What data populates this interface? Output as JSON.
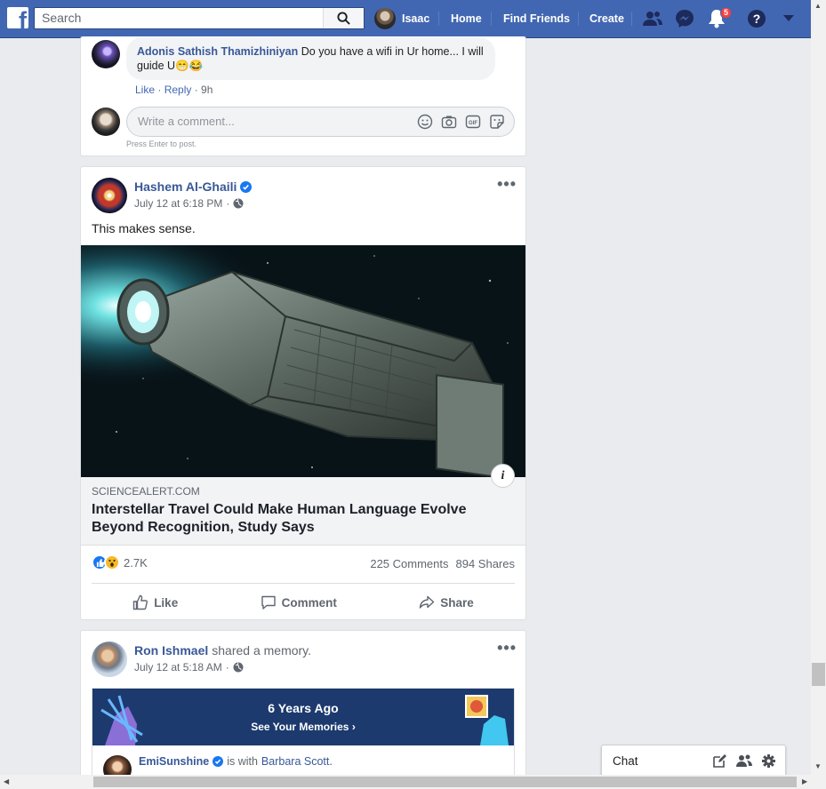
{
  "topbar": {
    "search_placeholder": "Search",
    "user_name": "Isaac",
    "nav": [
      "Home",
      "Find Friends",
      "Create"
    ],
    "notification_count": "5",
    "brand_color": "#4267b2"
  },
  "comment": {
    "author": "Adonis Sathish Thamizhiniyan",
    "text": "Do you have a wifi in Ur home... I will guide U😁😂",
    "like": "Like",
    "reply": "Reply",
    "time": "9h",
    "write_placeholder": "Write a comment...",
    "hint": "Press Enter to post."
  },
  "post1": {
    "author": "Hashem Al-Ghaili",
    "time": "July 12 at 6:18 PM",
    "text": "This makes sense.",
    "link_domain": "SCIENCEALERT.COM",
    "link_title": "Interstellar Travel Could Make Human Language Evolve Beyond Recognition, Study Says",
    "reaction_count": "2.7K",
    "comments": "225 Comments",
    "shares": "894 Shares",
    "actions": {
      "like": "Like",
      "comment": "Comment",
      "share": "Share"
    }
  },
  "post2": {
    "author": "Ron Ishmael",
    "action_text": "shared a memory.",
    "time": "July 12 at 5:18 AM",
    "memory_title": "6 Years Ago",
    "memory_link": "See Your Memories",
    "inner_author": "EmiSunshine",
    "inner_with": "is with",
    "inner_tagged": "Barbara Scott."
  },
  "chat": {
    "label": "Chat"
  }
}
